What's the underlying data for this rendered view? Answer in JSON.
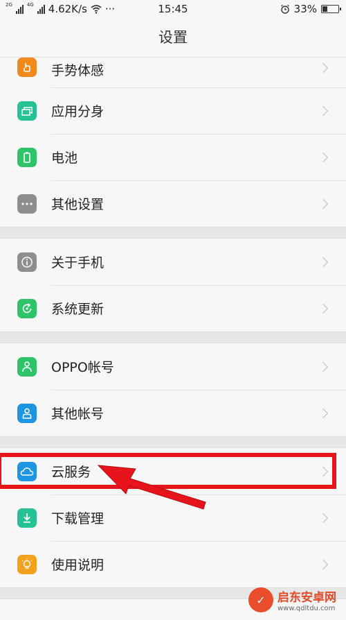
{
  "status_bar": {
    "network_speed": "4.62K/s",
    "more": "···",
    "time": "15:45",
    "battery_percent": "33%",
    "battery_level": 0.33,
    "net_2g": "2G",
    "net_4g": "4G"
  },
  "header": {
    "title": "设置"
  },
  "groups": [
    {
      "items": [
        {
          "label": "手势体感",
          "icon": "hand-gesture-icon",
          "color": "#f08a1d"
        },
        {
          "label": "应用分身",
          "icon": "app-clone-icon",
          "color": "#27c293"
        },
        {
          "label": "电池",
          "icon": "battery-icon",
          "color": "#2fc36a"
        },
        {
          "label": "其他设置",
          "icon": "more-dots-icon",
          "color": "#8e8e8e"
        }
      ]
    },
    {
      "items": [
        {
          "label": "关于手机",
          "icon": "info-icon",
          "color": "#8e8e8e"
        },
        {
          "label": "系统更新",
          "icon": "system-update-icon",
          "color": "#2fc36a"
        }
      ]
    },
    {
      "items": [
        {
          "label": "OPPO帐号",
          "icon": "person-icon",
          "color": "#2fc36a"
        },
        {
          "label": "其他帐号",
          "icon": "account-icon",
          "color": "#1d95e0"
        }
      ]
    },
    {
      "items": [
        {
          "label": "云服务",
          "icon": "cloud-icon",
          "color": "#1d95e0"
        },
        {
          "label": "下载管理",
          "icon": "download-icon",
          "color": "#27c293"
        },
        {
          "label": "使用说明",
          "icon": "bulb-icon",
          "color": "#f2a21d"
        }
      ]
    }
  ],
  "annotation": {
    "highlight_color": "#e8141b"
  },
  "watermark": {
    "title": "启东安卓网",
    "url": "www.qdltdu.com"
  }
}
